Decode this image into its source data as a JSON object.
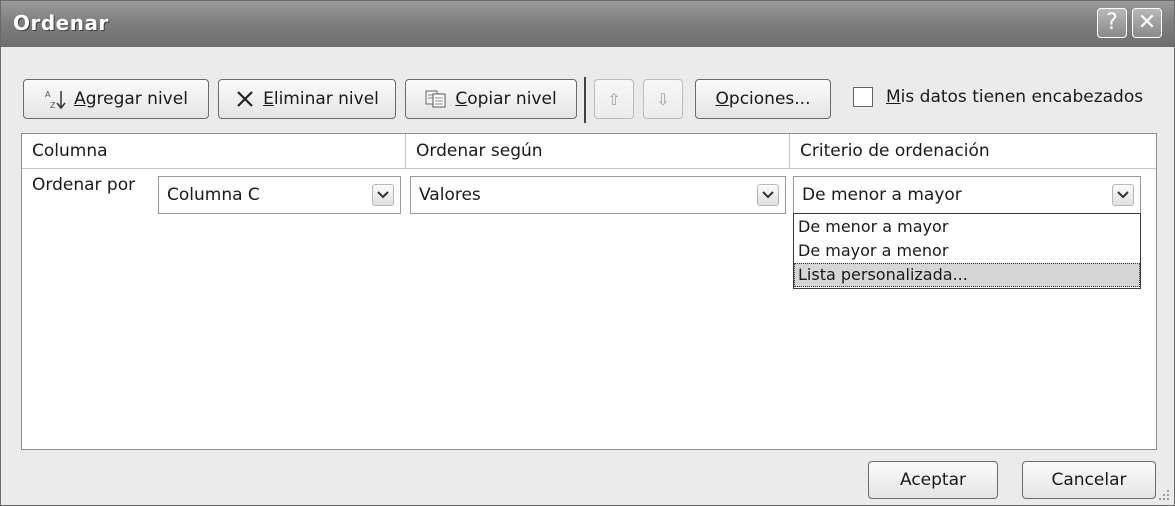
{
  "window": {
    "title": "Ordenar",
    "help_glyph": "?",
    "close_glyph": "✕"
  },
  "toolbar": {
    "add_level": {
      "pre": "",
      "mnemonic": "A",
      "post": "gregar nivel"
    },
    "delete_level": {
      "pre": "",
      "mnemonic": "E",
      "post": "liminar nivel"
    },
    "copy_level": {
      "pre": "",
      "mnemonic": "C",
      "post": "opiar nivel"
    },
    "options": {
      "pre": "",
      "mnemonic": "O",
      "post": "pciones..."
    },
    "move_up_glyph": "⇧",
    "move_down_glyph": "⇩"
  },
  "headers_checkbox": {
    "checked": false,
    "label_mnemonic": "M",
    "label_rest": "is datos tienen encabezados"
  },
  "grid": {
    "columns": [
      "Columna",
      "Ordenar según",
      "Criterio de ordenación"
    ],
    "row": {
      "label": "Ordenar por",
      "column_value": "Columna C",
      "sort_on_value": "Valores",
      "order_value": "De menor a mayor"
    }
  },
  "order_dropdown": {
    "options": [
      "De menor a mayor",
      "De mayor a menor",
      "Lista personalizada..."
    ],
    "highlighted_index": 2
  },
  "footer": {
    "ok_label": "Aceptar",
    "cancel_label": "Cancelar"
  },
  "colors": {
    "titlebar": "#7d7d7d",
    "dialog_bg": "#ebebeb",
    "highlight": "#d6d6d6"
  }
}
